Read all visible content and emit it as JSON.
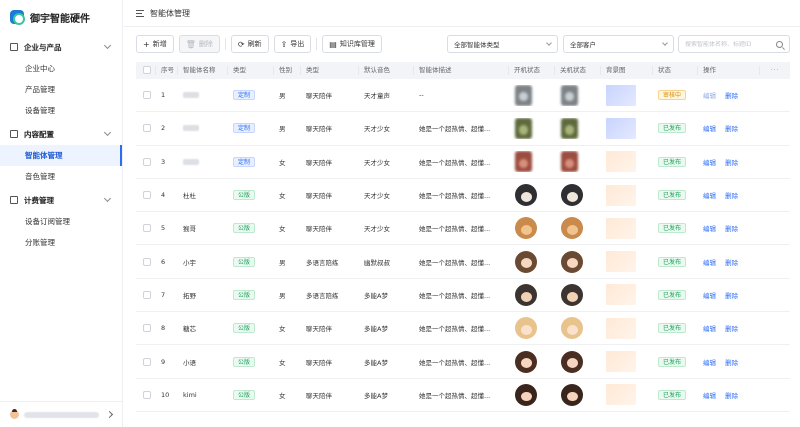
{
  "brand": {
    "name": "御宇智能硬件"
  },
  "topbar": {
    "title": "智能体管理"
  },
  "sidebar": {
    "groups": [
      {
        "label": "企业与产品",
        "items": [
          "企业中心",
          "产品管理",
          "设备管理"
        ]
      },
      {
        "label": "内容配置",
        "items": [
          "智能体管理",
          "音色管理"
        ]
      },
      {
        "label": "计费管理",
        "items": [
          "设备订阅管理",
          "分账管理"
        ]
      }
    ],
    "active_item": "智能体管理"
  },
  "toolbar": {
    "add": "新增",
    "delete": "删除",
    "refresh": "刷新",
    "export": "导出",
    "knowledge": "知识库管理",
    "filter_type": "全部智能体类型",
    "filter_customer": "全部客户",
    "search_placeholder": "搜索智能体名称、标题ID"
  },
  "table": {
    "columns": [
      "序号",
      "智能体名称",
      "类型",
      "性别",
      "类型",
      "默认音色",
      "智能体描述",
      "开机状态",
      "关机状态",
      "背景图",
      "状态",
      "操作",
      "···"
    ],
    "edit_label": "编辑",
    "delete_label": "删除",
    "rows": [
      {
        "no": "1",
        "name": "",
        "type": "定制",
        "gender": "男",
        "category": "聊天陪伴",
        "voice": "天才童声",
        "desc": "--",
        "status": "审核中",
        "avatar": "blur-gray",
        "bg": "blue"
      },
      {
        "no": "2",
        "name": "",
        "type": "定制",
        "gender": "男",
        "category": "聊天陪伴",
        "voice": "天才少女",
        "desc": "她是一个超热情、超懂...",
        "status": "已发布",
        "avatar": "blur-green",
        "bg": "blue"
      },
      {
        "no": "3",
        "name": "",
        "type": "定制",
        "gender": "女",
        "category": "聊天陪伴",
        "voice": "天才少女",
        "desc": "她是一个超热情、超懂...",
        "status": "已发布",
        "avatar": "blur-red",
        "bg": "peach"
      },
      {
        "no": "4",
        "name": "杜杜",
        "type": "公版",
        "gender": "女",
        "category": "聊天陪伴",
        "voice": "天才少女",
        "desc": "她是一个超热情、超懂...",
        "status": "已发布",
        "avatar": "monkey",
        "bg": "peach"
      },
      {
        "no": "5",
        "name": "猴哥",
        "type": "公版",
        "gender": "女",
        "category": "聊天陪伴",
        "voice": "天才少女",
        "desc": "她是一个超热情、超懂...",
        "status": "已发布",
        "avatar": "wukong",
        "bg": "peach"
      },
      {
        "no": "6",
        "name": "小宇",
        "type": "公版",
        "gender": "男",
        "category": "多语言陪练",
        "voice": "幽默叔叔",
        "desc": "她是一个超热情、超懂...",
        "status": "已发布",
        "avatar": "boy",
        "bg": "peach"
      },
      {
        "no": "7",
        "name": "拓野",
        "type": "公版",
        "gender": "男",
        "category": "多语言陪练",
        "voice": "多能A梦",
        "desc": "她是一个超热情、超懂...",
        "status": "已发布",
        "avatar": "boy2",
        "bg": "peach"
      },
      {
        "no": "8",
        "name": "糖芯",
        "type": "公版",
        "gender": "女",
        "category": "聊天陪伴",
        "voice": "多能A梦",
        "desc": "她是一个超热情、超懂...",
        "status": "已发布",
        "avatar": "girl-blonde",
        "bg": "peach"
      },
      {
        "no": "9",
        "name": "小语",
        "type": "公版",
        "gender": "女",
        "category": "聊天陪伴",
        "voice": "多能A梦",
        "desc": "她是一个超热情、超懂...",
        "status": "已发布",
        "avatar": "girl",
        "bg": "peach"
      },
      {
        "no": "10",
        "name": "kimi",
        "type": "公版",
        "gender": "女",
        "category": "聊天陪伴",
        "voice": "多能A梦",
        "desc": "她是一个超热情、超懂...",
        "status": "已发布",
        "avatar": "girl2",
        "bg": "peach"
      }
    ]
  },
  "colors": {
    "primary": "#2d6cf6",
    "tag_custom_bg": "#e8efff",
    "tag_custom_fg": "#2d6cf6",
    "tag_public_bg": "#eafaf0",
    "tag_public_fg": "#1aa05a",
    "status_review_bg": "#fff6e0",
    "status_review_fg": "#d68a00",
    "status_pub_bg": "#eafaf0",
    "status_pub_fg": "#1aa05a"
  }
}
